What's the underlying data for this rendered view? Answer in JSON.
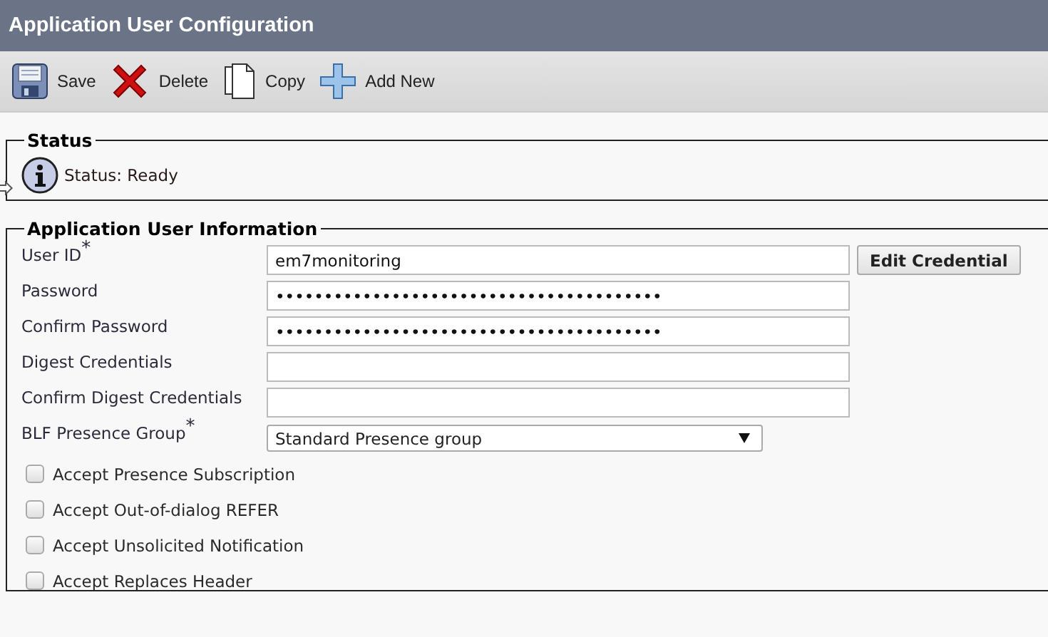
{
  "window": {
    "title": "Application User Configuration"
  },
  "toolbar": [
    {
      "kind": "save",
      "label": "Save"
    },
    {
      "kind": "delete",
      "label": "Delete"
    },
    {
      "kind": "copy",
      "label": "Copy"
    },
    {
      "kind": "add",
      "label": "Add New"
    }
  ],
  "status": {
    "legend": "Status",
    "message": "Status: Ready"
  },
  "info": {
    "legend": "Application User Information",
    "fields": [
      {
        "kind": "text",
        "label": "User ID$^{*}$",
        "value": "em7monitoring",
        "button": "Edit Credential"
      },
      {
        "kind": "text",
        "label": "Password",
        "value": "••••••••••••••••••••••••••••••••••••••••"
      },
      {
        "kind": "text",
        "label": "Confirm Password",
        "value": "••••••••••••••••••••••••••••••••••••••••"
      },
      {
        "kind": "text",
        "label": "Digest Credentials"
      },
      {
        "kind": "text",
        "label": "Confirm Digest Credentials"
      },
      {
        "kind": "select",
        "label": "BLF Presence Group$^{*}$",
        "value": "Standard Presence group"
      }
    ],
    "checkboxes": [
      {
        "label": "Accept Presence Subscription",
        "checked": false
      },
      {
        "label": "Accept Out-of-dialog REFER",
        "checked": false
      },
      {
        "label": "Accept Unsolicited Notification",
        "checked": false
      },
      {
        "label": "Accept Replaces Header",
        "checked": false
      }
    ]
  }
}
